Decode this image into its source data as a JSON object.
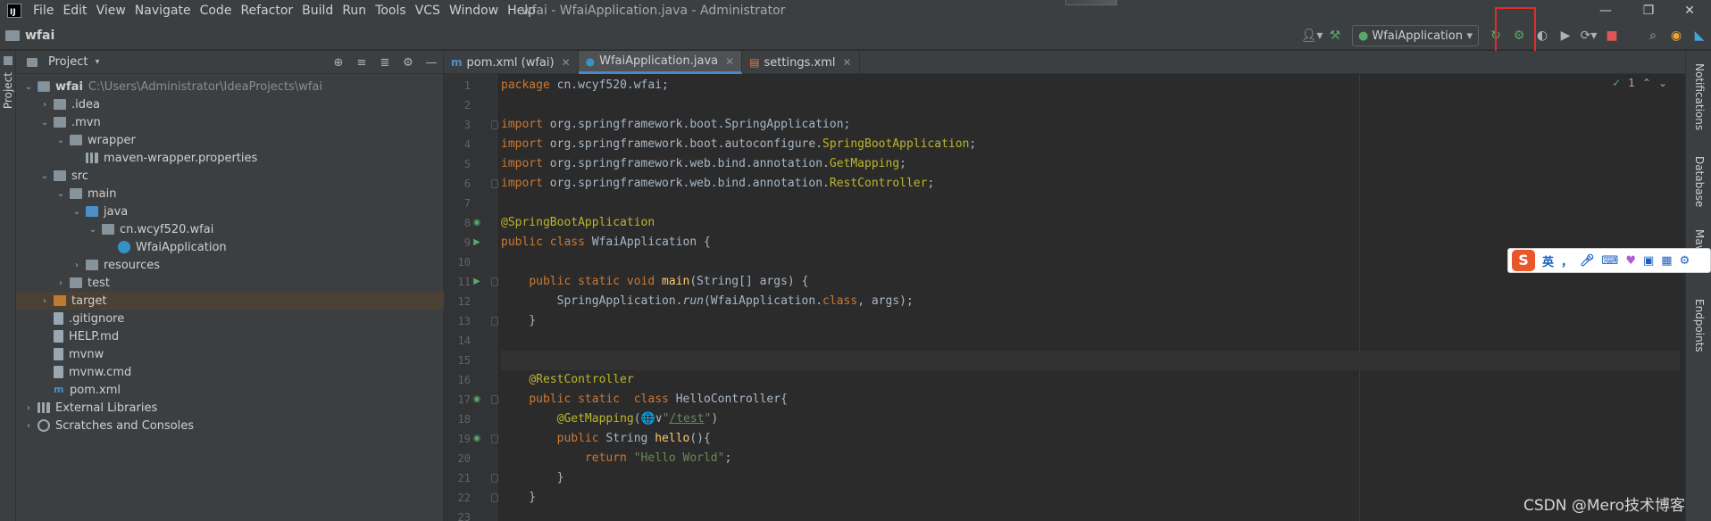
{
  "menubar": {
    "logo": "IJ",
    "items": [
      "File",
      "Edit",
      "View",
      "Navigate",
      "Code",
      "Refactor",
      "Build",
      "Run",
      "Tools",
      "VCS",
      "Window",
      "Help"
    ],
    "window_title": "wfai - WfaiApplication.java - Administrator",
    "controls": [
      "minimize-icon",
      "restore-icon",
      "close-icon"
    ]
  },
  "navbar": {
    "project_name": "wfai",
    "run_config": "WfaiApplication"
  },
  "left_stripe": {
    "label": "Project"
  },
  "project_panel": {
    "title": "Project",
    "tree": [
      {
        "label": "wfai",
        "extra": "C:\\Users\\Administrator\\IdeaProjects\\wfai",
        "depth": 0,
        "caret": "open",
        "icon": "module",
        "state": ""
      },
      {
        "label": ".idea",
        "depth": 1,
        "caret": "closed",
        "icon": "folder",
        "state": ""
      },
      {
        "label": ".mvn",
        "depth": 1,
        "caret": "open",
        "icon": "folder",
        "state": ""
      },
      {
        "label": "wrapper",
        "depth": 2,
        "caret": "open",
        "icon": "folder",
        "state": ""
      },
      {
        "label": "maven-wrapper.properties",
        "depth": 3,
        "caret": "",
        "icon": "lib",
        "state": ""
      },
      {
        "label": "src",
        "depth": 1,
        "caret": "open",
        "icon": "folder",
        "state": ""
      },
      {
        "label": "main",
        "depth": 2,
        "caret": "open",
        "icon": "folder",
        "state": ""
      },
      {
        "label": "java",
        "depth": 3,
        "caret": "open",
        "icon": "folder-blue",
        "state": ""
      },
      {
        "label": "cn.wcyf520.wfai",
        "depth": 4,
        "caret": "open",
        "icon": "package",
        "state": ""
      },
      {
        "label": "WfaiApplication",
        "depth": 5,
        "caret": "",
        "icon": "class",
        "state": ""
      },
      {
        "label": "resources",
        "depth": 3,
        "caret": "closed",
        "icon": "folder",
        "state": ""
      },
      {
        "label": "test",
        "depth": 2,
        "caret": "closed",
        "icon": "folder",
        "state": ""
      },
      {
        "label": "target",
        "depth": 1,
        "caret": "closed",
        "icon": "folder-orange",
        "state": "selected"
      },
      {
        "label": ".gitignore",
        "depth": 1,
        "caret": "",
        "icon": "file",
        "state": ""
      },
      {
        "label": "HELP.md",
        "depth": 1,
        "caret": "",
        "icon": "file",
        "state": ""
      },
      {
        "label": "mvnw",
        "depth": 1,
        "caret": "",
        "icon": "file",
        "state": ""
      },
      {
        "label": "mvnw.cmd",
        "depth": 1,
        "caret": "",
        "icon": "file",
        "state": ""
      },
      {
        "label": "pom.xml",
        "depth": 1,
        "caret": "",
        "icon": "file-m",
        "state": ""
      },
      {
        "label": "External Libraries",
        "depth": 0,
        "caret": "closed",
        "icon": "lib",
        "state": ""
      },
      {
        "label": "Scratches and Consoles",
        "depth": 0,
        "caret": "closed",
        "icon": "scratch",
        "state": ""
      }
    ]
  },
  "tabs": [
    {
      "label": "pom.xml (wfai)",
      "icon": "m",
      "active": false
    },
    {
      "label": "WfaiApplication.java",
      "icon": "c",
      "active": true
    },
    {
      "label": "settings.xml",
      "icon": "x",
      "active": false
    }
  ],
  "editor": {
    "inspection_count": "1",
    "lines": [
      {
        "n": "1",
        "html": "<span class=\"kw\">package </span>cn.wcyf520.wfai;"
      },
      {
        "n": "2",
        "html": ""
      },
      {
        "n": "3",
        "html": "<span class=\"kw\">import </span>org.springframework.boot.SpringApplication;"
      },
      {
        "n": "4",
        "html": "<span class=\"kw\">import </span>org.springframework.boot.autoconfigure.<span class=\"ann\">SpringBootApplication</span>;"
      },
      {
        "n": "5",
        "html": "<span class=\"kw\">import </span>org.springframework.web.bind.annotation.<span class=\"ann\">GetMapping</span>;"
      },
      {
        "n": "6",
        "html": "<span class=\"kw\">import </span>org.springframework.web.bind.annotation.<span class=\"ann\">RestController</span>;"
      },
      {
        "n": "7",
        "html": ""
      },
      {
        "n": "8",
        "html": "<span class=\"ann\">@SpringBootApplication</span>"
      },
      {
        "n": "9",
        "html": "<span class=\"kw\">public class </span>WfaiApplication {"
      },
      {
        "n": "10",
        "html": ""
      },
      {
        "n": "11",
        "html": "    <span class=\"kw\">public static void </span><span class=\"fn\">main</span>(String[] args) {"
      },
      {
        "n": "12",
        "html": "        SpringApplication.<span class=\"it\">run</span>(WfaiApplication.<span class=\"kw\">class</span>, args);"
      },
      {
        "n": "13",
        "html": "    }"
      },
      {
        "n": "14",
        "html": ""
      },
      {
        "n": "15",
        "html": ""
      },
      {
        "n": "16",
        "html": "    <span class=\"ann\">@RestController</span>"
      },
      {
        "n": "17",
        "html": "    <span class=\"kw\">public static  class </span>HelloController{"
      },
      {
        "n": "18",
        "html": "        <span class=\"ann\">@GetMapping</span>(&#x1F310;&#x2228;<span class=\"str\">\"</span><span class=\"url\">/test</span><span class=\"str\">\"</span>)"
      },
      {
        "n": "19",
        "html": "        <span class=\"kw\">public </span>String <span class=\"fn\">hello</span>(){"
      },
      {
        "n": "20",
        "html": "            <span class=\"kw\">return </span><span class=\"str\">\"Hello World\"</span>;"
      },
      {
        "n": "21",
        "html": "        }"
      },
      {
        "n": "22",
        "html": "    }"
      },
      {
        "n": "23",
        "html": ""
      }
    ],
    "current_line": "15"
  },
  "right_stripe": [
    "Notifications",
    "Database",
    "Maven",
    "Endpoints"
  ],
  "ime": {
    "logo": "S",
    "mode": "英"
  },
  "watermark": "CSDN @Mero技术博客"
}
